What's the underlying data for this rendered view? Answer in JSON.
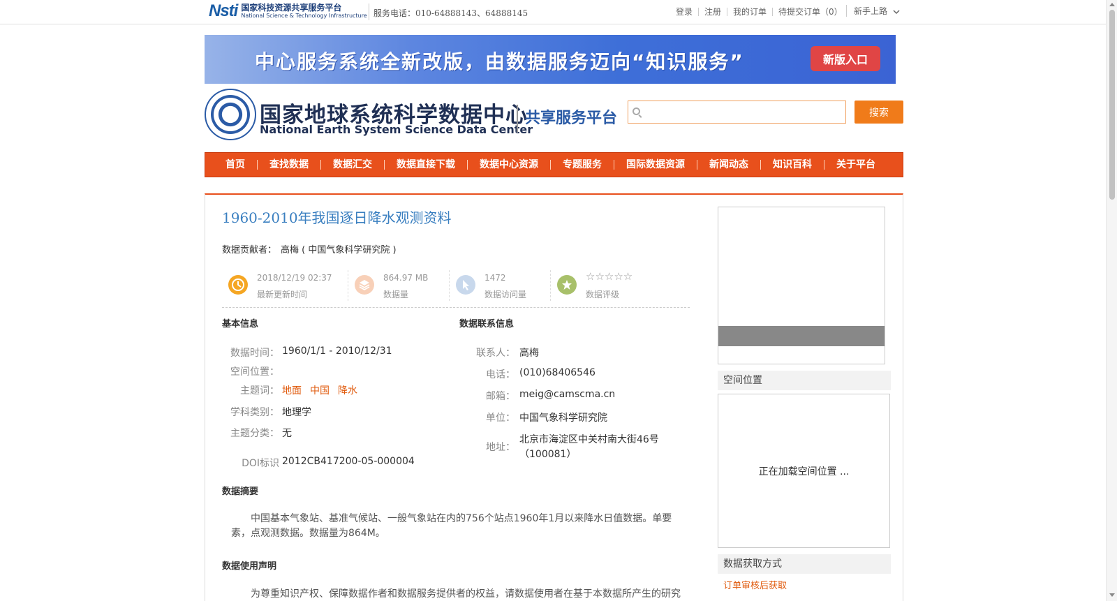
{
  "topbar": {
    "nsti_mark": "Nsti",
    "nsti_cn": "国家科技资源共享服务平台",
    "nsti_en": "National Science & Technology Infrastructure",
    "phone": "服务电话：010-64888143、64888145",
    "links": [
      "登录",
      "注册",
      "我的订单",
      "待提交订单（0）"
    ],
    "guide": "新手上路"
  },
  "banner": {
    "text": "中心服务系统全新改版，由数据服务迈向“知识服务”",
    "button": "新版入口"
  },
  "header": {
    "name_cn": "国家地球系统科学数据中心",
    "name_en": "National Earth System Science Data Center",
    "platform": "共享服务平台",
    "search_placeholder": "",
    "search_button": "搜索"
  },
  "nav": [
    "首页",
    "查找数据",
    "数据汇交",
    "数据直接下载",
    "数据中心资源",
    "专题服务",
    "国际数据资源",
    "新闻动态",
    "知识百科",
    "关于平台"
  ],
  "dataset": {
    "title": "1960-2010年我国逐日降水观测资料",
    "contributor_label": "数据贡献者：",
    "contributor": "高梅 ( 中国气象科学研究院 )",
    "stats": {
      "updated": "2018/12/19 02:37",
      "updated_label": "最新更新时间",
      "size": "864.97 MB",
      "size_label": "数据量",
      "visits": "1472",
      "visits_label": "数据访问量",
      "stars": "☆☆☆☆☆",
      "rating_label": "数据评级"
    },
    "basic": {
      "title": "基本信息",
      "time_label": "数据时间：",
      "time": "1960/1/1 - 2010/12/31",
      "space_label": "空间位置：",
      "keywords_label": "主题词：",
      "keywords": [
        "地面",
        "中国",
        "降水"
      ],
      "discipline_label": "学科类别：",
      "discipline": "地理学",
      "category_label": "主题分类：",
      "category": "无",
      "doi_label": "DOI标识",
      "doi": "2012CB417200-05-000004"
    },
    "contact": {
      "title": "数据联系信息",
      "person_label": "联系人：",
      "person": "高梅",
      "phone_label": "电话：",
      "phone": "(010)68406546",
      "email_label": "邮箱：",
      "email": "meig@camscma.cn",
      "unit_label": "单位：",
      "unit": "中国气象科学研究院",
      "address_label": "地址：",
      "address_line1": "北京市海淀区中关村南大街46号",
      "address_line2": "（100081）"
    },
    "abstract": {
      "title": "数据摘要",
      "text": "中国基本气象站、基准气候站、一般气象站在内的756个站点1960年1月以来降水日值数据。单要素，点观测数据。数据量为864M。"
    },
    "usage": {
      "title": "数据使用声明",
      "text": "为尊重知识产权、保障数据作者和数据服务提供者的权益，请数据使用者在基于本数据所产生的研究"
    }
  },
  "side": {
    "space_title": "空间位置",
    "map_loading": "正在加载空间位置 ...",
    "access_title": "数据获取方式",
    "access_link": "订单审核后获取"
  },
  "colors": {
    "nav_bg": "#e8501c",
    "accent_orange": "#f07b1a",
    "title_blue": "#3a7fc0",
    "tag_orange": "#e05a0c"
  }
}
